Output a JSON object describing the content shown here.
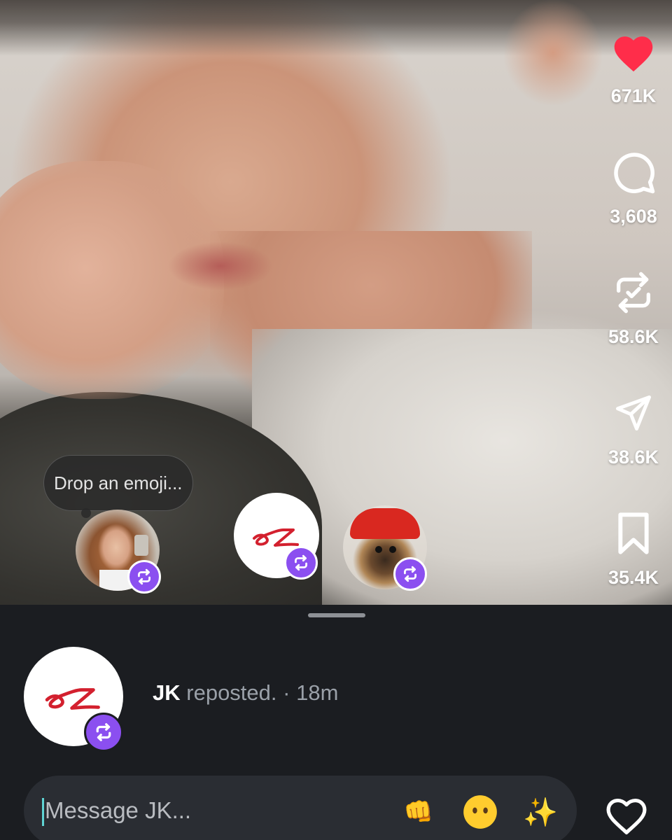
{
  "actions": {
    "like": {
      "count": "671K",
      "icon": "heart-filled-icon",
      "color": "#ff2d4a",
      "liked": true
    },
    "comment": {
      "count": "3,608",
      "icon": "comment-icon"
    },
    "repost": {
      "count": "58.6K",
      "icon": "repost-check-icon"
    },
    "share": {
      "count": "38.6K",
      "icon": "send-icon"
    },
    "save": {
      "count": "35.4K",
      "icon": "bookmark-icon"
    }
  },
  "reposters": {
    "bubble_text": "Drop an emoji...",
    "badge_color": "#8b4ff0",
    "brand_color": "#d3202e"
  },
  "sheet": {
    "repost": {
      "name": "JK",
      "action": "reposted.",
      "separator": "·",
      "time": "18m"
    },
    "composer": {
      "placeholder": "Message JK...",
      "emoji_1": "👊",
      "emoji_2": "😶",
      "emoji_3": "✨"
    },
    "heart_icon": "heart-outline-icon"
  }
}
